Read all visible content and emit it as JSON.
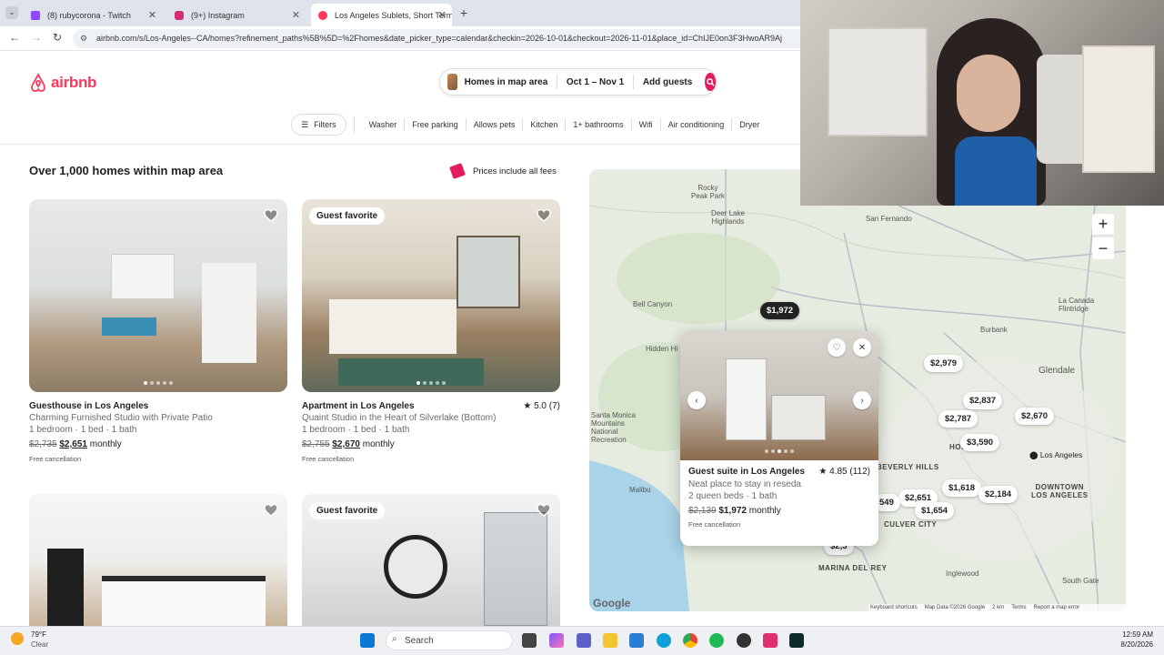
{
  "browser": {
    "tabs": [
      {
        "title": "(8) rubycorona - Twitch",
        "color": "#9146ff"
      },
      {
        "title": "(9+) Instagram",
        "color": "#d62976"
      },
      {
        "title": "Los Angeles Sublets, Short Term",
        "color": "#ff385c"
      }
    ],
    "url": "airbnb.com/s/Los-Angeles--CA/homes?refinement_paths%5B%5D=%2Fhomes&date_picker_type=calendar&checkin=2026-10-01&checkout=2026-11-01&place_id=ChIJE0on3F3HwoAR9Aj"
  },
  "header": {
    "logo": "airbnb",
    "brand_color": "#ff385c",
    "search": {
      "location": "Homes in map area",
      "dates": "Oct 1 – Nov 1",
      "guests": "Add guests"
    }
  },
  "filters": {
    "filters_label": "Filters",
    "chips": [
      "Washer",
      "Free parking",
      "Allows pets",
      "Kitchen",
      "1+ bathrooms",
      "Wifi",
      "Air conditioning",
      "Dryer"
    ]
  },
  "results": {
    "heading": "Over 1,000 homes within map area",
    "prices_note": "Prices include all fees"
  },
  "listings": [
    {
      "type": "Guesthouse in Los Angeles",
      "title": "Charming Furnished Studio with Private Patio",
      "beds": "1 bedroom · 1 bed · 1 bath",
      "old_price": "$2,735",
      "price": "$2,651",
      "period": "monthly",
      "note": "Free cancellation",
      "badge": "",
      "rating": ""
    },
    {
      "type": "Apartment in Los Angeles",
      "title": "Quaint Studio in the Heart of Silverlake (Bottom)",
      "beds": "1 bedroom · 1 bed · 1 bath",
      "old_price": "$2,755",
      "price": "$2,670",
      "period": "monthly",
      "note": "Free cancellation",
      "badge": "Guest favorite",
      "rating": "★ 5.0 (7)"
    },
    {
      "badge": ""
    },
    {
      "badge": "Guest favorite"
    }
  ],
  "map": {
    "labels": {
      "rocky_peak": "Rocky\nPeak Park",
      "deer_lake": "Deer Lake\nHighlands",
      "san_fernando": "San Fernando",
      "bell_canyon": "Bell Canyon",
      "hidden_hills": "Hidden Hi",
      "burbank": "Burbank",
      "la_canada": "La Canada\nFlintridge",
      "glendale": "Glendale",
      "santa_monica": "Santa Monica\nMountains\nNational\nRecreation",
      "malibu": "Malibu",
      "beverly_hills": "BEVERLY HILLS",
      "culver_city": "CULVER CITY",
      "marina": "MARINA DEL REY",
      "downtown": "DOWNTOWN\nLOS ANGELES",
      "los_angeles": "Los Angeles",
      "hollywood": "HOLL",
      "south_gate": "South Gate",
      "inglewood": "Inglewood"
    },
    "pins": [
      "$1,972",
      "$2,979",
      "$2,837",
      "$2,787",
      "$2,670",
      "$3,590",
      "$1,618",
      "$2,651",
      "$2,184",
      "$1,654",
      "549",
      "$2,3"
    ],
    "popup": {
      "type": "Guest suite in Los Angeles",
      "rating": "★ 4.85 (112)",
      "desc": "Neat place to stay in reseda",
      "beds": "2 queen beds · 1 bath",
      "old_price": "$2,139",
      "price": "$1,972",
      "period": "monthly",
      "note": "Free cancellation"
    },
    "google": "Google",
    "footer": {
      "shortcuts": "Keyboard shortcuts",
      "data": "Map Data ©2026 Google",
      "scale": "2 km",
      "terms": "Terms",
      "report": "Report a map error"
    },
    "zoom_in": "+",
    "zoom_out": "−"
  },
  "taskbar": {
    "weather_temp": "79°F",
    "weather_desc": "Clear",
    "search": "Search",
    "time": "12:59 AM",
    "date": "8/20/2026"
  }
}
